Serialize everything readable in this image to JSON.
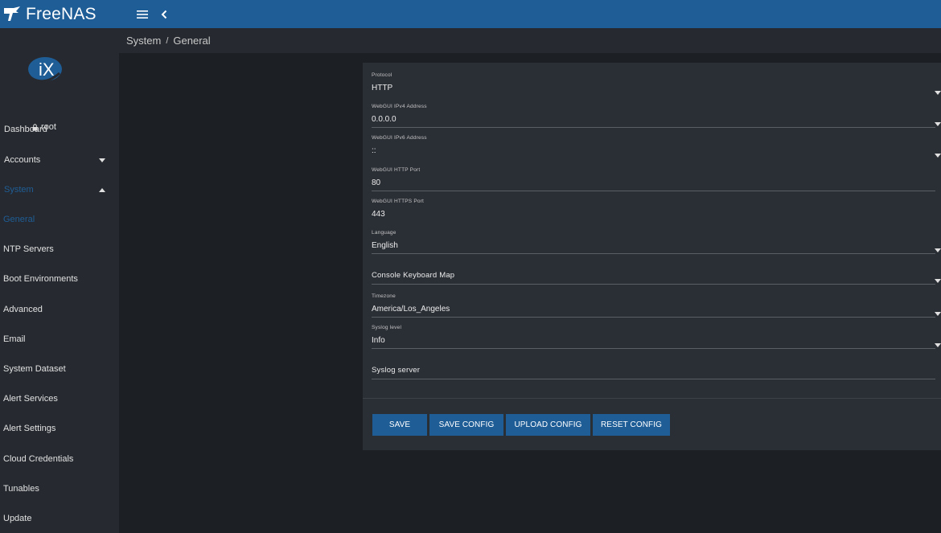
{
  "app": {
    "name": "FreeNAS"
  },
  "user": {
    "name": "root"
  },
  "breadcrumb": {
    "section": "System",
    "separator": "/",
    "page": "General"
  },
  "sidebar": {
    "items": [
      {
        "label": "Dashboard"
      },
      {
        "label": "Accounts"
      },
      {
        "label": "System"
      },
      {
        "label": "General"
      },
      {
        "label": "NTP Servers"
      },
      {
        "label": "Boot Environments"
      },
      {
        "label": "Advanced"
      },
      {
        "label": "Email"
      },
      {
        "label": "System Dataset"
      },
      {
        "label": "Alert Services"
      },
      {
        "label": "Alert Settings"
      },
      {
        "label": "Cloud Credentials"
      },
      {
        "label": "Tunables"
      },
      {
        "label": "Update"
      }
    ]
  },
  "form": {
    "fields": [
      {
        "label": "Protocol",
        "value": "HTTP"
      },
      {
        "label": "WebGUI IPv4 Address",
        "value": "0.0.0.0"
      },
      {
        "label": "WebGUI IPv6 Address",
        "value": "::"
      },
      {
        "label": "WebGUI HTTP Port",
        "value": "80"
      },
      {
        "label": "WebGUI HTTPS Port",
        "value": "443"
      },
      {
        "label": "Language",
        "value": "English"
      },
      {
        "label": "",
        "value": "Console Keyboard Map"
      },
      {
        "label": "Timezone",
        "value": "America/Los_Angeles"
      },
      {
        "label": "Syslog level",
        "value": "Info"
      },
      {
        "label": "",
        "value": "Syslog server"
      }
    ],
    "help_glyph": "{"
  },
  "buttons": {
    "save": "SAVE",
    "save_config": "SAVE CONFIG",
    "upload_config": "UPLOAD CONFIG",
    "reset_config": "RESET CONFIG"
  },
  "colors": {
    "topbar": "#1f5d96",
    "accent": "#1f5d96",
    "sidebar": "#262a30",
    "background": "#1c1f24",
    "card": "#2a2e35"
  }
}
